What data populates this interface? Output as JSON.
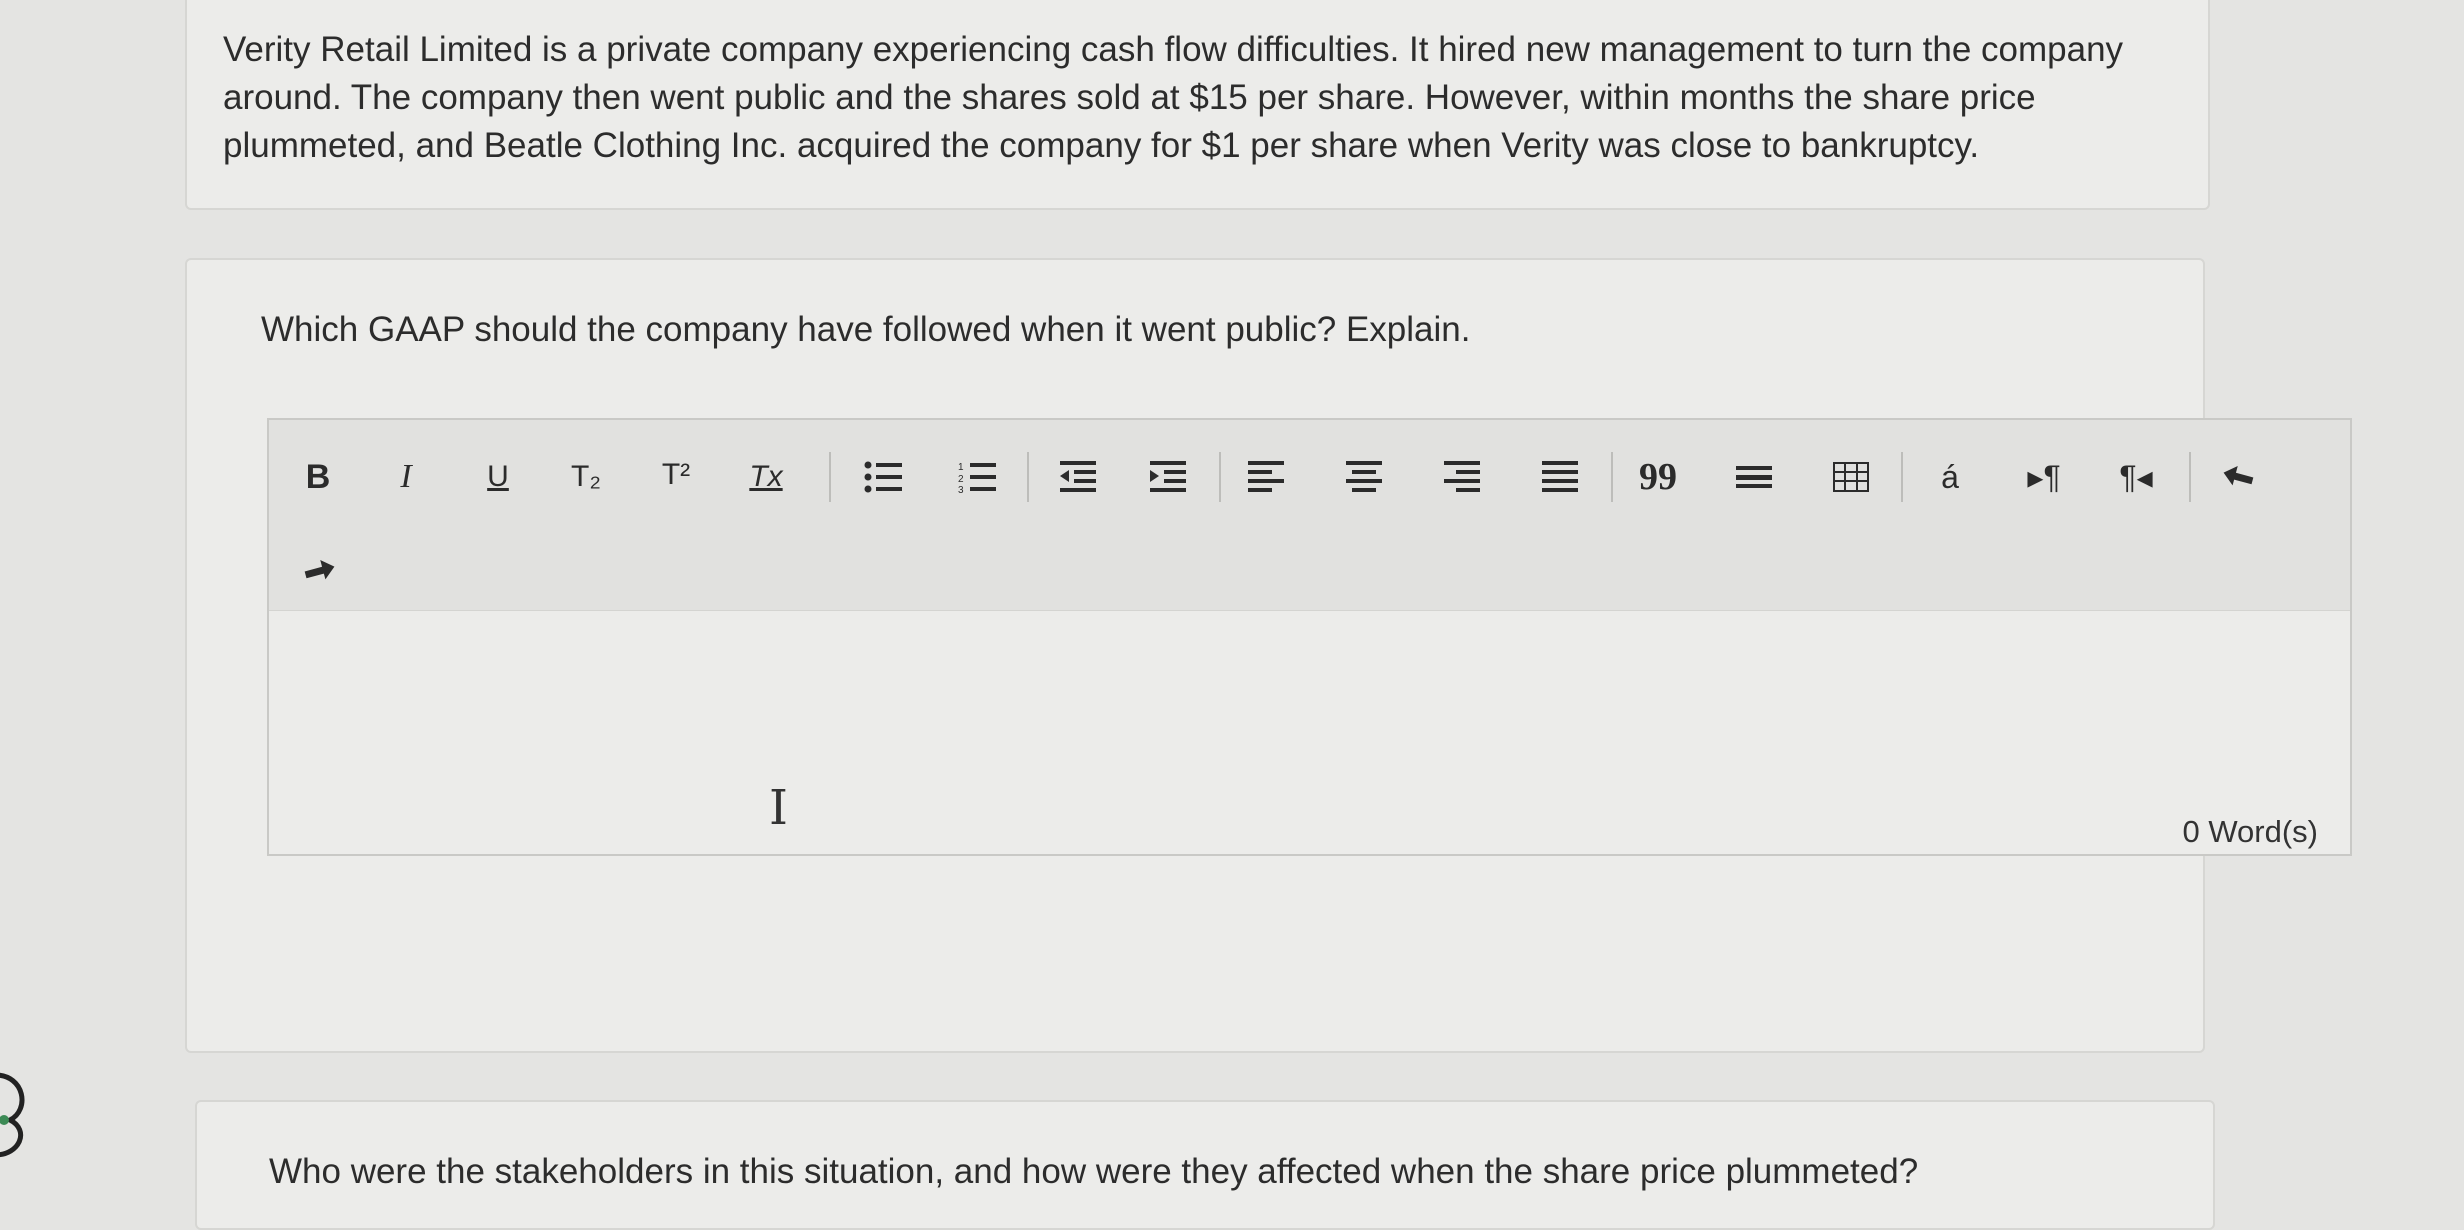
{
  "passage": {
    "text": "Verity Retail Limited is a private company experiencing cash flow difficulties. It hired new management to turn the company around. The company then went public and the shares sold at $15 per share. However, within months the share price plummeted, and Beatle Clothing Inc. acquired the company for $1 per share when Verity was close to bankruptcy."
  },
  "question1": {
    "prompt": "Which GAAP should the company have followed when it went public? Explain."
  },
  "editor": {
    "toolbar": {
      "bold": "B",
      "italic": "I",
      "underline": "U",
      "subscript": "T₂",
      "superscript": "T²",
      "clear_format": "Tx",
      "blockquote": "99",
      "special_char": "á",
      "ltr": "▸¶",
      "rtl": "¶◂"
    },
    "icons": [
      "bold-icon",
      "italic-icon",
      "underline-icon",
      "subscript-icon",
      "superscript-icon",
      "clear-format-icon",
      "bulleted-list-icon",
      "numbered-list-icon",
      "outdent-icon",
      "indent-icon",
      "align-left-icon",
      "align-center-icon",
      "align-right-icon",
      "justify-icon",
      "blockquote-icon",
      "horizontal-rule-icon",
      "table-icon",
      "special-character-icon",
      "ltr-icon",
      "rtl-icon",
      "undo-icon",
      "redo-icon"
    ],
    "word_count": "0 Word(s)"
  },
  "question2": {
    "prompt": "Who were the stakeholders in this situation, and how were they affected when the share price plummeted?"
  },
  "colors": {
    "page_bg": "#e4e4e2",
    "card_bg": "#ececea",
    "toolbar_bg": "#e1e1df",
    "text": "#2c2c2c"
  }
}
